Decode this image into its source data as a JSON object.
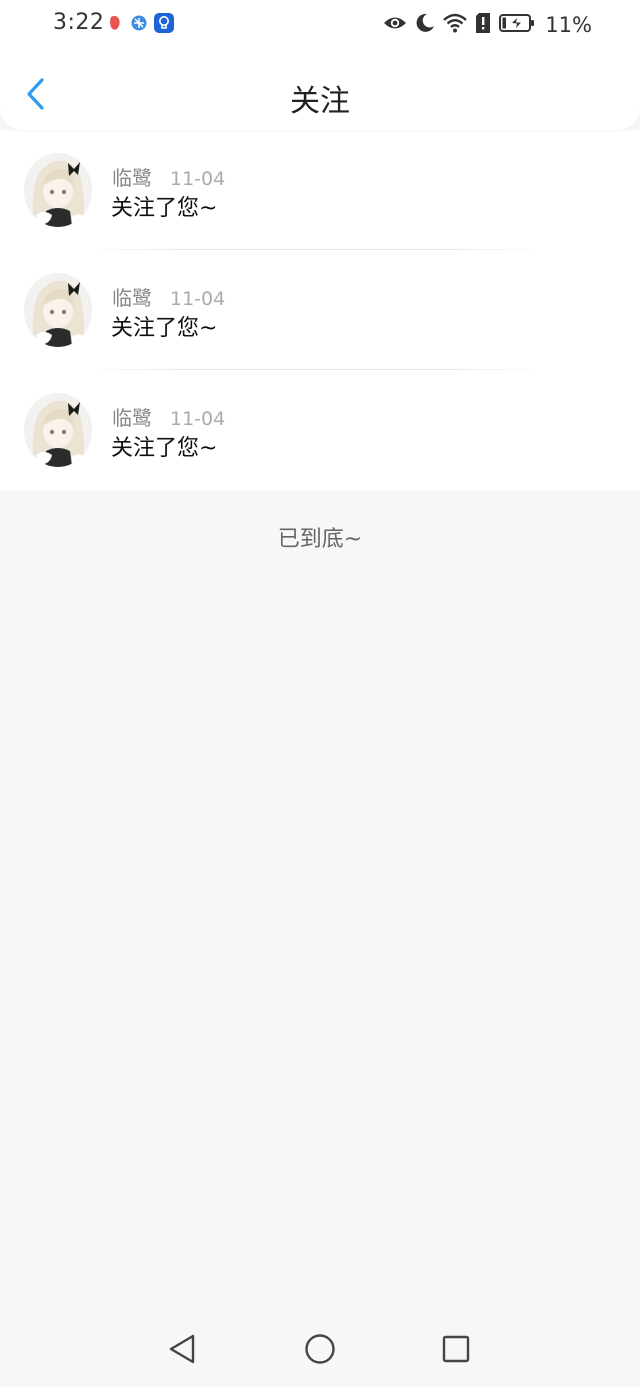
{
  "status_bar": {
    "time": "3:22",
    "battery": "11%",
    "notification_icons": [
      "record-icon",
      "vpn-icon",
      "bulb-app-icon"
    ],
    "system_icons": [
      "eye-icon",
      "moon-icon",
      "wifi-icon",
      "sim-alert-icon",
      "battery-icon"
    ]
  },
  "header": {
    "title": "关注",
    "back_icon": "chevron-left-icon",
    "accent_color": "#2d9cf0"
  },
  "notifications": [
    {
      "name": "临鹭",
      "date": "11-04",
      "message": "关注了您~"
    },
    {
      "name": "临鹭",
      "date": "11-04",
      "message": "关注了您~"
    },
    {
      "name": "临鹭",
      "date": "11-04",
      "message": "关注了您~"
    }
  ],
  "end_text": "已到底~",
  "nav_bar": {
    "icons": [
      "back-triangle-icon",
      "home-circle-icon",
      "recents-square-icon"
    ]
  }
}
